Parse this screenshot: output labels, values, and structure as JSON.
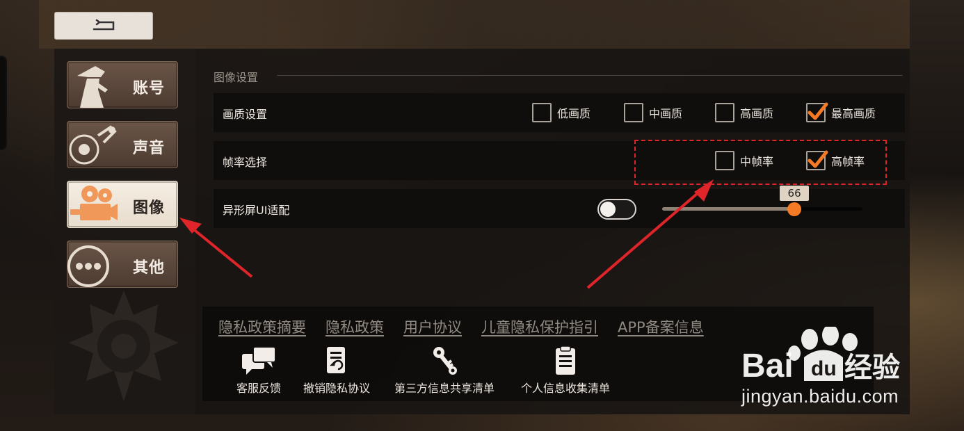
{
  "sidebar": {
    "items": [
      {
        "label": "账号",
        "icon": "detective-icon",
        "active": false
      },
      {
        "label": "声音",
        "icon": "record-player-icon",
        "active": false
      },
      {
        "label": "图像",
        "icon": "film-camera-icon",
        "active": true
      },
      {
        "label": "其他",
        "icon": "more-icon",
        "active": false
      }
    ]
  },
  "settings": {
    "section_title": "图像设置",
    "quality": {
      "label": "画质设置",
      "options": [
        {
          "label": "低画质",
          "checked": false
        },
        {
          "label": "中画质",
          "checked": false
        },
        {
          "label": "高画质",
          "checked": false
        },
        {
          "label": "最高画质",
          "checked": true
        }
      ]
    },
    "framerate": {
      "label": "帧率选择",
      "options": [
        {
          "label": "中帧率",
          "checked": false
        },
        {
          "label": "高帧率",
          "checked": true
        }
      ]
    },
    "notch": {
      "label": "异形屏UI适配",
      "toggle_on": false,
      "slider_value": "66",
      "slider_fraction": 0.66
    }
  },
  "footer": {
    "links": [
      "隐私政策摘要",
      "隐私政策",
      "用户协议",
      "儿童隐私保护指引",
      "APP备案信息"
    ],
    "tools": [
      {
        "label": "客服反馈",
        "icon": "chat-bubbles-icon"
      },
      {
        "label": "撤销隐私协议",
        "icon": "revoke-document-icon"
      },
      {
        "label": "第三方信息共享清单",
        "icon": "key-icon"
      },
      {
        "label": "个人信息收集清单",
        "icon": "clipboard-icon"
      }
    ]
  },
  "watermark": {
    "text": "jingyan.baidu.com",
    "logo": "Bai du 经验"
  },
  "colors": {
    "accent": "#f47a26",
    "highlight": "#e0252a"
  }
}
